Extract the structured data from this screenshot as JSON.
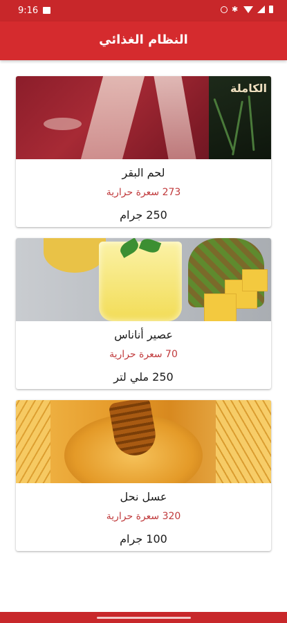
{
  "status_bar": {
    "time": "9:16",
    "icons": [
      "image-icon",
      "alarm-icon",
      "bluetooth-icon",
      "wifi-icon",
      "signal-icon",
      "battery-icon"
    ]
  },
  "app_bar": {
    "title": "النظام الغذائي",
    "color": "#d52b2e"
  },
  "foods": [
    {
      "name": "لحم البقر",
      "calories": "273 سعرة حرارية",
      "amount": "250 جرام",
      "image_logo": "الكاملة"
    },
    {
      "name": "عصير أناناس",
      "calories": "70 سعرة حرارية",
      "amount": "250 ملي لتر"
    },
    {
      "name": "عسل نحل",
      "calories": "320 سعرة حرارية",
      "amount": "100 جرام"
    }
  ],
  "colors": {
    "primary": "#d52b2e",
    "calorie_text": "#c0393b"
  }
}
